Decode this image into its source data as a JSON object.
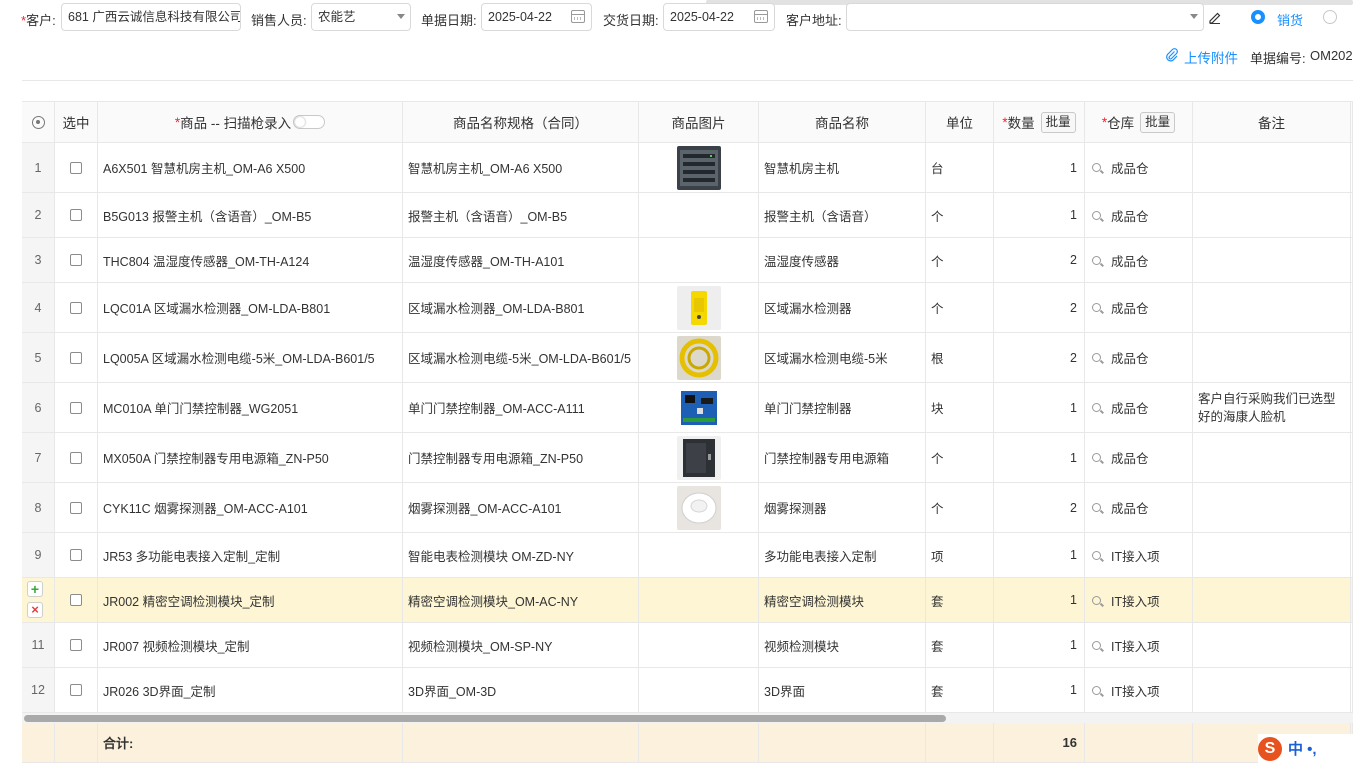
{
  "header": {
    "customer_label": "客户:",
    "customer_value": "681 广西云诚信息科技有限公司",
    "sales_label": "销售人员:",
    "sales_value": "农能艺",
    "doc_date_label": "单据日期:",
    "doc_date_value": "2025-04-22",
    "delivery_date_label": "交货日期:",
    "delivery_date_value": "2025-04-22",
    "address_label": "客户地址:",
    "address_value": "",
    "radio_sales_label": "销货",
    "upload_label": "上传附件",
    "doc_no_label": "单据编号:",
    "doc_no_value": "OM202"
  },
  "table": {
    "headers": {
      "select": "选中",
      "product": "商品 -- 扫描枪录入",
      "spec": "商品名称规格（合同）",
      "image": "商品图片",
      "name": "商品名称",
      "unit": "单位",
      "qty": "数量",
      "warehouse": "仓库",
      "remark": "备注",
      "batch": "批量"
    },
    "rows": [
      {
        "no": "1",
        "product": "A6X501 智慧机房主机_OM-A6 X500",
        "spec": "智慧机房主机_OM-A6 X500",
        "image": "device-rack-photo",
        "name": "智慧机房主机",
        "unit": "台",
        "qty": "1",
        "warehouse": "成品仓",
        "remark": ""
      },
      {
        "no": "2",
        "product": "B5G013 报警主机（含语音）_OM-B5",
        "spec": "报警主机（含语音）_OM-B5",
        "image": "",
        "name": "报警主机（含语音）",
        "unit": "个",
        "qty": "1",
        "warehouse": "成品仓",
        "remark": ""
      },
      {
        "no": "3",
        "product": "THC804 温湿度传感器_OM-TH-A124",
        "spec": "温湿度传感器_OM-TH-A101",
        "image": "",
        "name": "温湿度传感器",
        "unit": "个",
        "qty": "2",
        "warehouse": "成品仓",
        "remark": ""
      },
      {
        "no": "4",
        "product": "LQC01A 区域漏水检测器_OM-LDA-B801",
        "spec": "区域漏水检测器_OM-LDA-B801",
        "image": "leak-detector-photo",
        "name": "区域漏水检测器",
        "unit": "个",
        "qty": "2",
        "warehouse": "成品仓",
        "remark": ""
      },
      {
        "no": "5",
        "product": "LQ005A 区域漏水检测电缆-5米_OM-LDA-B601/5",
        "spec": "区域漏水检测电缆-5米_OM-LDA-B601/5",
        "image": "cable-reel-photo",
        "name": "区域漏水检测电缆-5米",
        "unit": "根",
        "qty": "2",
        "warehouse": "成品仓",
        "remark": ""
      },
      {
        "no": "6",
        "product": "MC010A 单门门禁控制器_WG2051",
        "spec": "单门门禁控制器_OM-ACC-A111",
        "image": "circuit-board-photo",
        "name": "单门门禁控制器",
        "unit": "块",
        "qty": "1",
        "warehouse": "成品仓",
        "remark": "客户自行采购我们已选型好的海康人脸机"
      },
      {
        "no": "7",
        "product": "MX050A 门禁控制器专用电源箱_ZN-P50",
        "spec": "门禁控制器专用电源箱_ZN-P50",
        "image": "power-box-photo",
        "name": "门禁控制器专用电源箱",
        "unit": "个",
        "qty": "1",
        "warehouse": "成品仓",
        "remark": ""
      },
      {
        "no": "8",
        "product": "CYK11C 烟雾探测器_OM-ACC-A101",
        "spec": "烟雾探测器_OM-ACC-A101",
        "image": "smoke-detector-photo",
        "name": "烟雾探测器",
        "unit": "个",
        "qty": "2",
        "warehouse": "成品仓",
        "remark": ""
      },
      {
        "no": "9",
        "product": "JR53 多功能电表接入定制_定制",
        "spec": "智能电表检测模块 OM-ZD-NY",
        "image": "",
        "name": "多功能电表接入定制",
        "unit": "项",
        "qty": "1",
        "warehouse": "IT接入项",
        "remark": ""
      },
      {
        "no": "",
        "product": "JR002 精密空调检测模块_定制",
        "spec": "精密空调检测模块_OM-AC-NY",
        "image": "",
        "name": "精密空调检测模块",
        "unit": "套",
        "qty": "1",
        "warehouse": "IT接入项",
        "remark": ""
      },
      {
        "no": "11",
        "product": "JR007 视频检测模块_定制",
        "spec": "视频检测模块_OM-SP-NY",
        "image": "",
        "name": "视频检测模块",
        "unit": "套",
        "qty": "1",
        "warehouse": "IT接入项",
        "remark": ""
      },
      {
        "no": "12",
        "product": "JR026 3D界面_定制",
        "spec": "3D界面_OM-3D",
        "image": "",
        "name": "3D界面",
        "unit": "套",
        "qty": "1",
        "warehouse": "IT接入项",
        "remark": ""
      }
    ],
    "total_label": "合计:",
    "total_qty": "16"
  },
  "ime": {
    "logo": "S",
    "text": "中 •, "
  },
  "colors": {
    "accent": "#1890ff",
    "highlight_row": "#fdf5d3",
    "total_row": "#fbf1dc",
    "required": "#f5222d"
  }
}
